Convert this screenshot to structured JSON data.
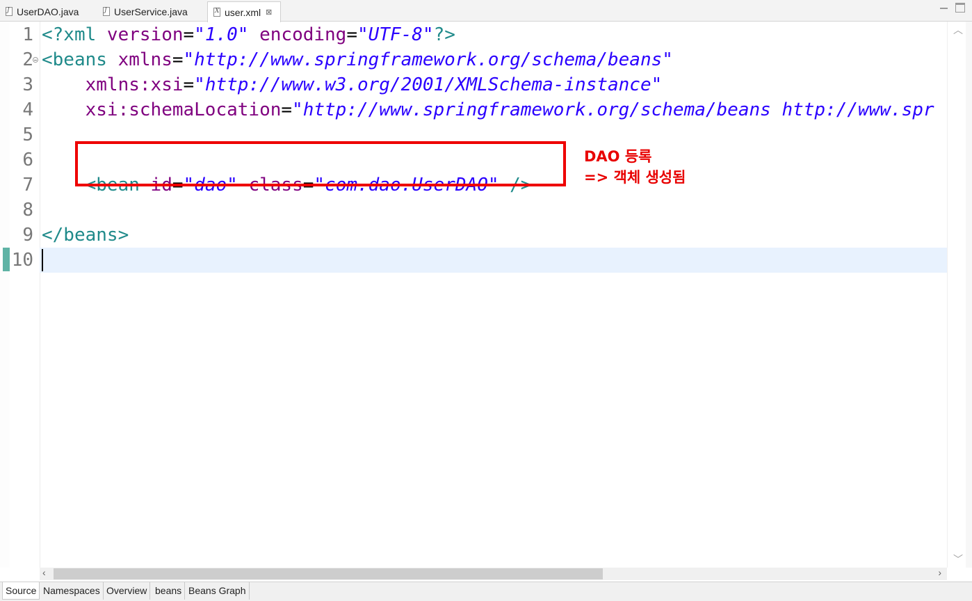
{
  "editor_tabs": [
    {
      "label": "UserDAO.java",
      "icon": "java-file-icon",
      "active": false
    },
    {
      "label": "UserService.java",
      "icon": "java-file-icon",
      "active": false
    },
    {
      "label": "user.xml",
      "icon": "xml-file-icon",
      "active": true
    }
  ],
  "tab_close_glyph": "⊠",
  "line_numbers": [
    "1",
    "2",
    "3",
    "4",
    "5",
    "6",
    "7",
    "8",
    "9",
    "10"
  ],
  "code": {
    "l1": {
      "open": "<?xml",
      "a1": " version",
      "eq1": "=",
      "v1": "\"1.0\"",
      "a2": " encoding",
      "eq2": "=",
      "v2": "\"UTF-8\"",
      "close": "?>"
    },
    "l2": {
      "open": "<beans",
      "a1": " xmlns",
      "eq1": "=",
      "v1": "\"http://www.springframework.org/schema/beans\""
    },
    "l3": {
      "indent": "    ",
      "a1": "xmlns:xsi",
      "eq1": "=",
      "v1": "\"http://www.w3.org/2001/XMLSchema-instance\""
    },
    "l4": {
      "indent": "    ",
      "a1": "xsi:schemaLocation",
      "eq1": "=",
      "v1": "\"http://www.springframework.org/schema/beans http://www.spr"
    },
    "l7": {
      "indent": "    ",
      "open": "<bean",
      "a1": " id",
      "eq1": "=",
      "v1": "\"dao\"",
      "a2": " class",
      "eq2": "=",
      "v2": "\"com.dao.UserDAO\"",
      "close": " />"
    },
    "l9": {
      "close": "</beans>"
    }
  },
  "annotation": {
    "line1": "DAO 등록",
    "line2": "=> 객체 생성됨"
  },
  "colors": {
    "highlight_box": "#ee0000",
    "annotation": "#e80000",
    "tag": "#1f8a8a",
    "attribute": "#7f007f",
    "value": "#2a00ff",
    "current_line": "#e8f2fe"
  },
  "page_tabs": [
    "Source",
    "Namespaces",
    "Overview",
    "beans",
    "Beans Graph"
  ],
  "active_page_tab": "Source"
}
